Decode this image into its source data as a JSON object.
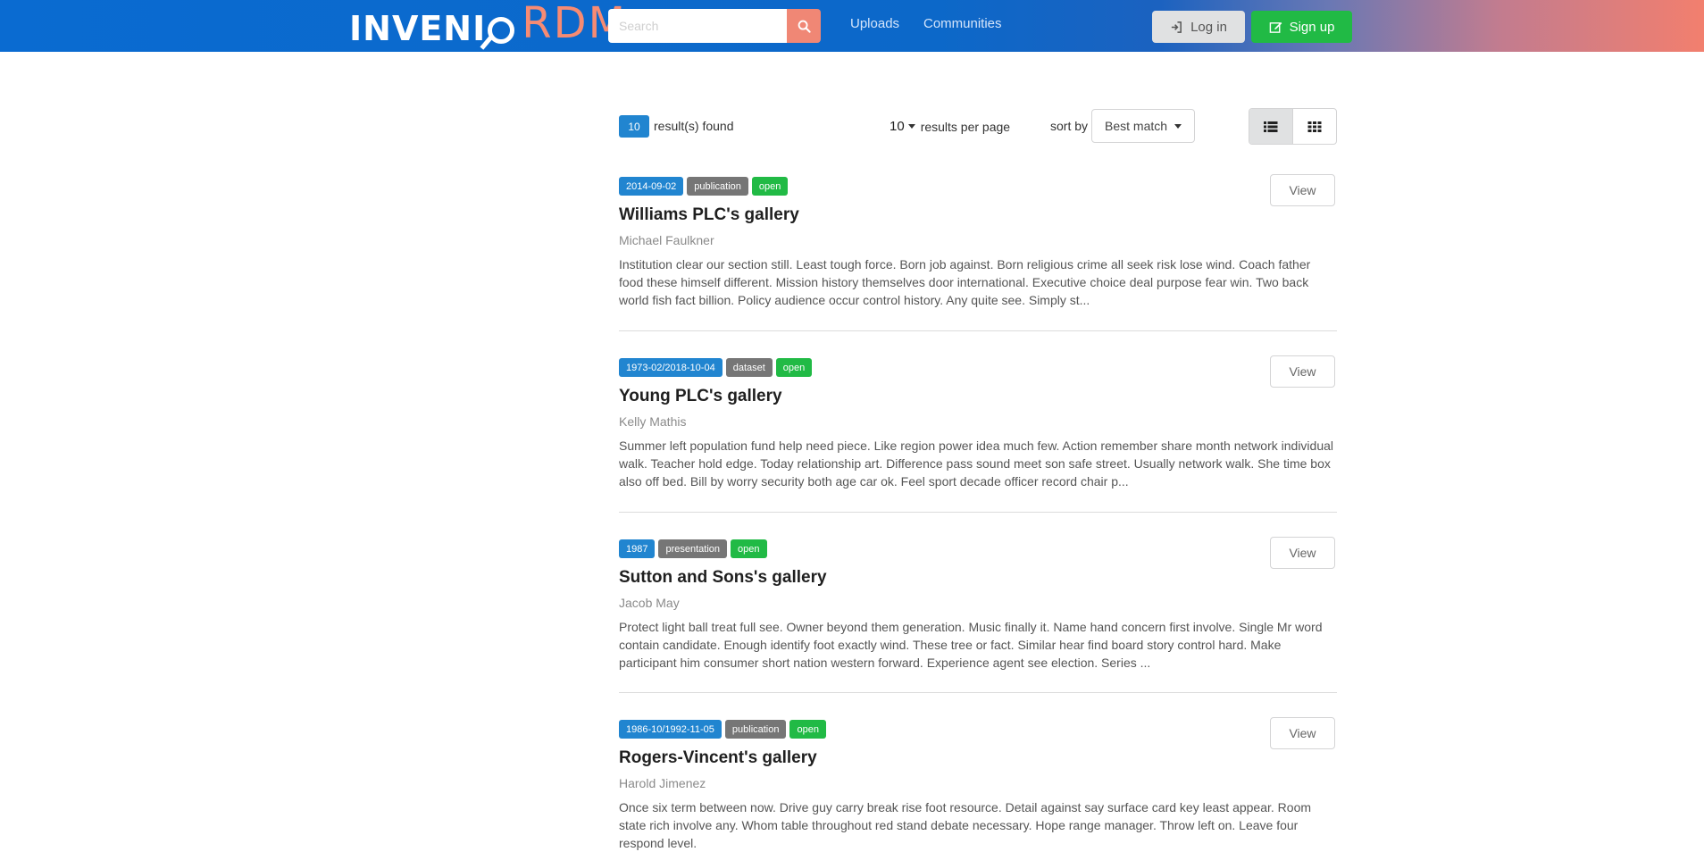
{
  "header": {
    "logo_main": "INVENI",
    "logo_accent": "RDM",
    "search_placeholder": "Search",
    "nav": [
      {
        "label": "Uploads"
      },
      {
        "label": "Communities"
      }
    ],
    "login_label": "Log in",
    "signup_label": "Sign up",
    "colors": {
      "search_button": "#f08775",
      "signup": "#21ba45",
      "login": "#e0e1e2"
    }
  },
  "results": {
    "count": "10",
    "count_text": "result(s) found",
    "per_page_value": "10",
    "per_page_text": "results per page",
    "sort_label": "sort by",
    "sort_value": "Best match",
    "layout_active": "list"
  },
  "records": [
    {
      "date": "2014-09-02",
      "type": "publication",
      "access": "open",
      "title": "Williams PLC's gallery",
      "author": "Michael Faulkner",
      "description": "Institution clear our section still. Least tough force. Born job against. Born religious crime all seek risk lose wind. Coach father food these himself different. Mission history themselves door international. Executive choice deal purpose fear win. Two back world fish fact billion. Policy audience occur control history. Any quite see. Simply st...",
      "view_label": "View"
    },
    {
      "date": "1973-02/2018-10-04",
      "type": "dataset",
      "access": "open",
      "title": "Young PLC's gallery",
      "author": "Kelly Mathis",
      "description": "Summer left population fund help need piece. Like region power idea much few. Action remember share month network individual walk. Teacher hold edge. Today relationship art. Difference pass sound meet son safe street. Usually network walk. She time box also off bed. Bill by worry security both age car ok. Feel sport decade officer record chair p...",
      "view_label": "View"
    },
    {
      "date": "1987",
      "type": "presentation",
      "access": "open",
      "title": "Sutton and Sons's gallery",
      "author": "Jacob May",
      "description": "Protect light ball treat full see. Owner beyond them generation. Music finally it. Name hand concern first involve. Single Mr word contain candidate. Enough identify foot exactly wind. These tree or fact. Similar hear find board story control hard. Make participant him consumer short nation western forward. Experience agent see election. Series ...",
      "view_label": "View"
    },
    {
      "date": "1986-10/1992-11-05",
      "type": "publication",
      "access": "open",
      "title": "Rogers-Vincent's gallery",
      "author": "Harold Jimenez",
      "description": "Once six term between now. Drive guy carry break rise foot resource. Detail against say surface card key least appear. Room state rich involve any. Whom table throughout red stand debate necessary. Hope range manager. Throw left on. Leave four respond level.",
      "view_label": "View"
    }
  ]
}
